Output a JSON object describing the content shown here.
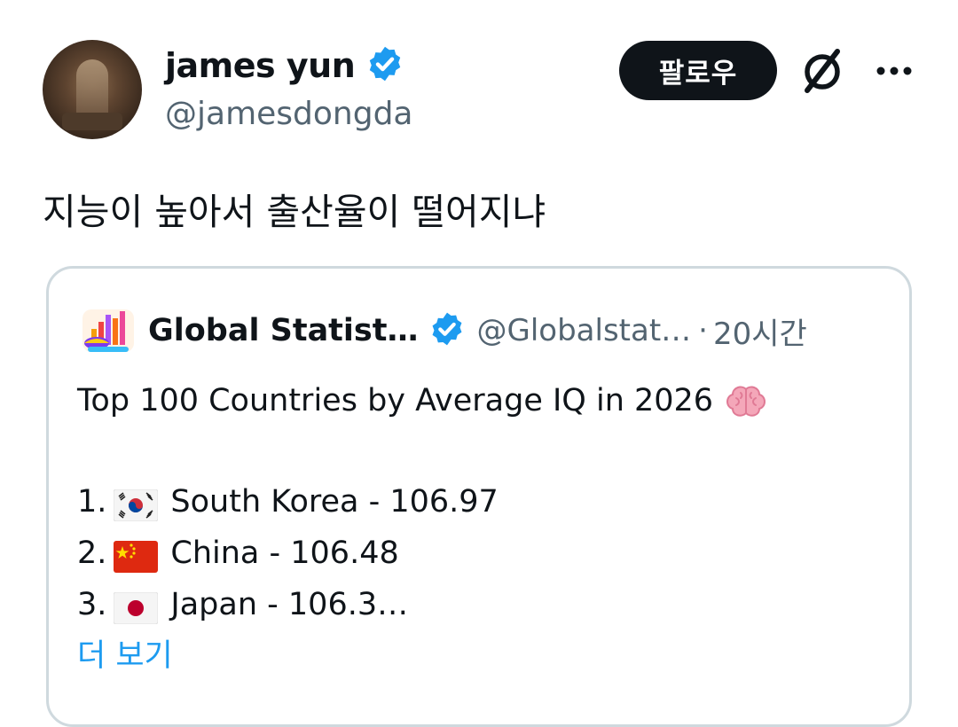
{
  "tweet": {
    "author_name": "james yun",
    "author_handle": "@jamesdongda",
    "follow_label": "팔로우",
    "text": "지능이 높아서 출산율이 떨어지냐"
  },
  "quote": {
    "author_name": "Global Statist…",
    "author_handle": "@Globalstat…",
    "separator": "·",
    "time": "20시간",
    "title": "Top 100 Countries by Average IQ in 2026",
    "items": [
      {
        "rank": "1.",
        "text": "South Korea - 106.97",
        "flag": "south-korea"
      },
      {
        "rank": "2.",
        "text": "China - 106.48",
        "flag": "china"
      },
      {
        "rank": "3.",
        "text": "Japan - 106.3…",
        "flag": "japan"
      }
    ],
    "show_more": "더 보기"
  },
  "colors": {
    "verified": "#1d9bf0",
    "link": "#1d9bf0",
    "secondary_text": "#536471",
    "border": "#cfd9de",
    "button_bg": "#0f1419"
  },
  "icons": [
    "verified-badge-icon",
    "grok-icon",
    "more-icon",
    "brain-emoji-icon"
  ]
}
